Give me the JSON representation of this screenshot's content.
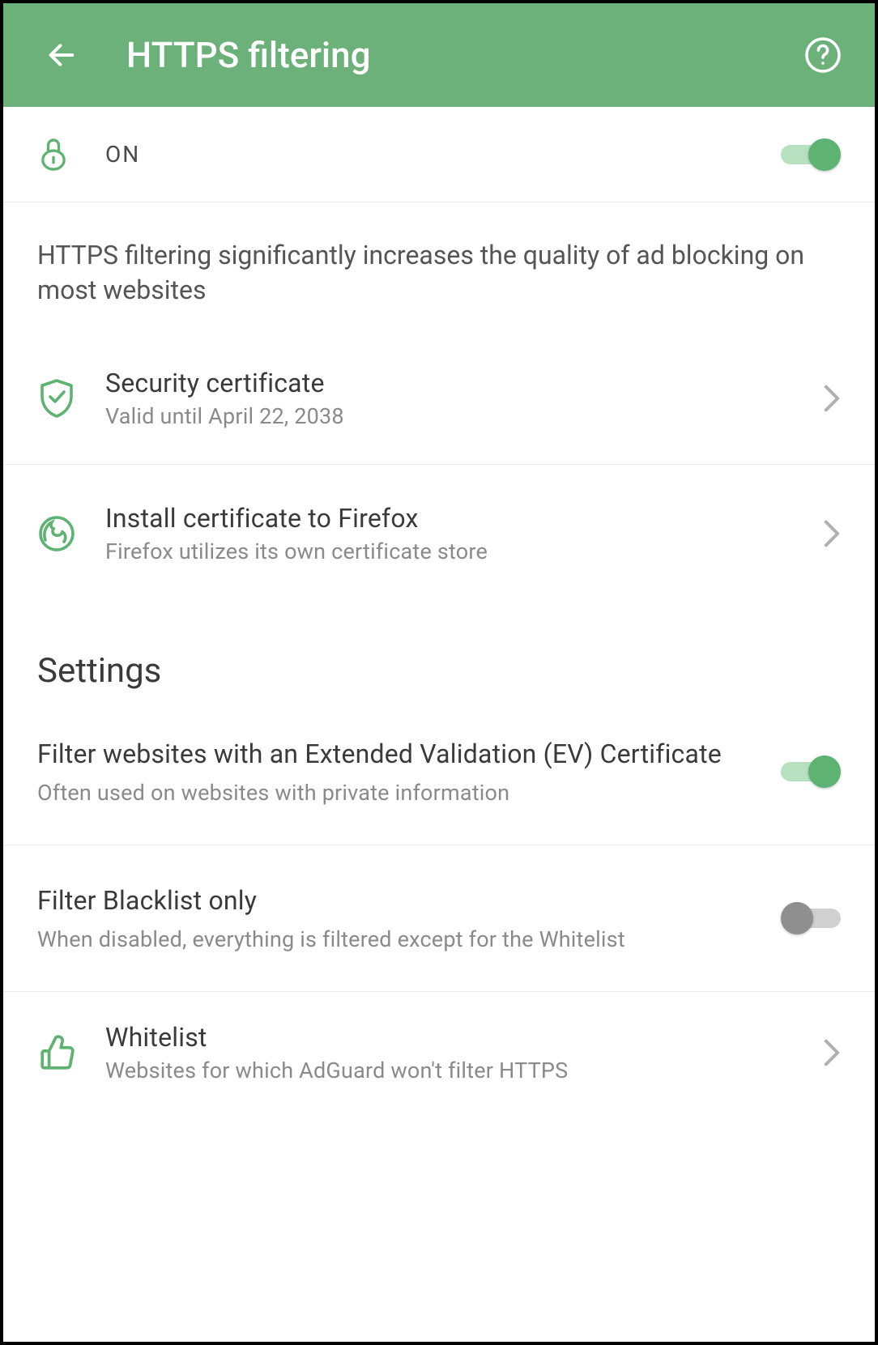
{
  "header": {
    "title": "HTTPS filtering"
  },
  "main": {
    "status_label": "ON",
    "status_on": true,
    "description": "HTTPS filtering significantly increases the quality of ad blocking on most websites",
    "certificate": {
      "title": "Security certificate",
      "subtitle": "Valid until April 22, 2038"
    },
    "firefox": {
      "title": "Install certificate to Firefox",
      "subtitle": "Firefox utilizes its own certificate store"
    }
  },
  "settings": {
    "header": "Settings",
    "ev": {
      "title": "Filter websites with an Extended Validation (EV) Certificate",
      "subtitle": "Often used on websites with private information",
      "on": true
    },
    "blacklist": {
      "title": "Filter Blacklist only",
      "subtitle": "When disabled, everything is filtered except for the Whitelist",
      "on": false
    },
    "whitelist": {
      "title": "Whitelist",
      "subtitle": "Websites for which AdGuard won't filter HTTPS"
    }
  },
  "colors": {
    "accent": "#6cb07a",
    "accent_dark": "#5eb272"
  }
}
